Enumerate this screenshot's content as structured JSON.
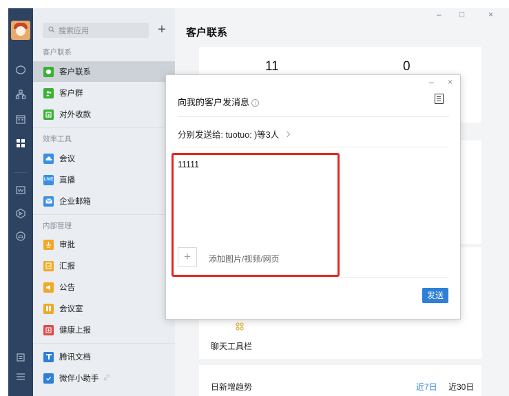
{
  "window": {
    "minimize_label": "–",
    "maximize_label": "□",
    "close_label": "×"
  },
  "rail": {
    "icons": [
      "chat-icon",
      "contacts-icon",
      "calendar-icon",
      "workbench-icon",
      "mail-icon",
      "package-icon",
      "cloud-icon",
      "notes-icon",
      "menu-icon"
    ]
  },
  "applist": {
    "search_placeholder": "搜索应用",
    "add_label": "+",
    "groups": [
      {
        "label": "客户联系",
        "items": [
          {
            "label": "客户联系",
            "icon": "chat-icon",
            "color": "#3cb034"
          },
          {
            "label": "客户群",
            "icon": "group-icon",
            "color": "#3cb034"
          },
          {
            "label": "对外收款",
            "icon": "payment-icon",
            "color": "#3cb034"
          }
        ]
      },
      {
        "label": "效率工具",
        "items": [
          {
            "label": "会议",
            "icon": "cloud-meeting-icon",
            "color": "#3a8ee6"
          },
          {
            "label": "直播",
            "icon": "live-icon",
            "color": "#3a8ee6",
            "badge": "LIVE"
          },
          {
            "label": "企业邮箱",
            "icon": "mail-icon",
            "color": "#3a8ee6"
          }
        ]
      },
      {
        "label": "内部管理",
        "items": [
          {
            "label": "审批",
            "icon": "approval-icon",
            "color": "#f2a825"
          },
          {
            "label": "汇报",
            "icon": "report-icon",
            "color": "#f2a825"
          },
          {
            "label": "公告",
            "icon": "announcement-icon",
            "color": "#f2a825"
          },
          {
            "label": "会议室",
            "icon": "meeting-room-icon",
            "color": "#f2a825"
          },
          {
            "label": "健康上报",
            "icon": "health-icon",
            "color": "#e54848"
          }
        ]
      },
      {
        "label": "",
        "items": [
          {
            "label": "腾讯文档",
            "icon": "tencent-docs-icon",
            "color": "#2d7fd8"
          },
          {
            "label": "微伴小助手",
            "icon": "check-icon",
            "color": "#2d7fd8"
          }
        ]
      }
    ]
  },
  "main": {
    "title": "客户联系",
    "stats": [
      "11",
      "0"
    ],
    "toolbar_label": "聊天工具栏",
    "trend": {
      "label": "日新增趋势",
      "range_7": "近7日",
      "range_30": "近30日"
    }
  },
  "dialog": {
    "title": "向我的客户发消息",
    "info_glyph": "i",
    "recipients": "分别发送给: tuotuo: )等3人",
    "message": "11111",
    "attach_label": "添加图片/视频/网页",
    "attach_glyph": "+",
    "send_label": "发送",
    "close_label": "×",
    "minimize_label": "–"
  },
  "colors": {
    "highlight": "#e5251d",
    "accent": "#2d7fd8",
    "rail": "#2d4361"
  }
}
